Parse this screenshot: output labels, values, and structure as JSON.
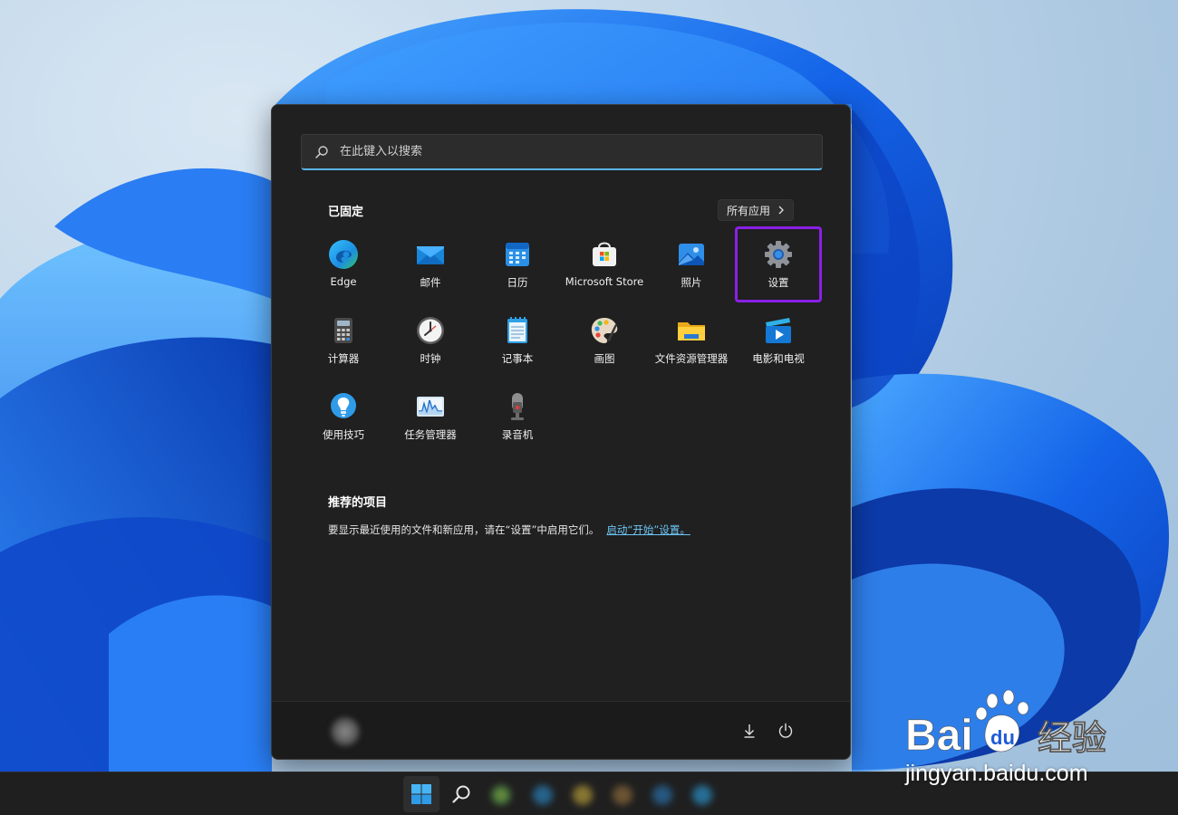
{
  "search": {
    "placeholder": "在此键入以搜索"
  },
  "pinned": {
    "title": "已固定",
    "all_apps_label": "所有应用",
    "apps": [
      {
        "label": "Edge",
        "icon": "edge-icon"
      },
      {
        "label": "邮件",
        "icon": "mail-icon"
      },
      {
        "label": "日历",
        "icon": "calendar-icon"
      },
      {
        "label": "Microsoft Store",
        "icon": "store-icon"
      },
      {
        "label": "照片",
        "icon": "photos-icon"
      },
      {
        "label": "设置",
        "icon": "gear-icon",
        "highlighted": true
      },
      {
        "label": "计算器",
        "icon": "calculator-icon"
      },
      {
        "label": "时钟",
        "icon": "clock-icon"
      },
      {
        "label": "记事本",
        "icon": "notepad-icon"
      },
      {
        "label": "画图",
        "icon": "paint-icon"
      },
      {
        "label": "文件资源管理器",
        "icon": "folder-icon"
      },
      {
        "label": "电影和电视",
        "icon": "movies-icon"
      },
      {
        "label": "使用技巧",
        "icon": "tips-icon"
      },
      {
        "label": "任务管理器",
        "icon": "task-manager-icon"
      },
      {
        "label": "录音机",
        "icon": "voice-recorder-icon"
      }
    ]
  },
  "recommended": {
    "title": "推荐的项目",
    "text": "要显示最近使用的文件和新应用，请在“设置”中启用它们。",
    "link": "启动“开始”设置。"
  },
  "watermark": {
    "url": "jingyan.baidu.com",
    "brand": "Baidu经验"
  },
  "colors": {
    "highlight": "#8a20e6",
    "accent": "#5ab3e8",
    "menu_bg": "#202020",
    "link": "#6cc5f5"
  }
}
